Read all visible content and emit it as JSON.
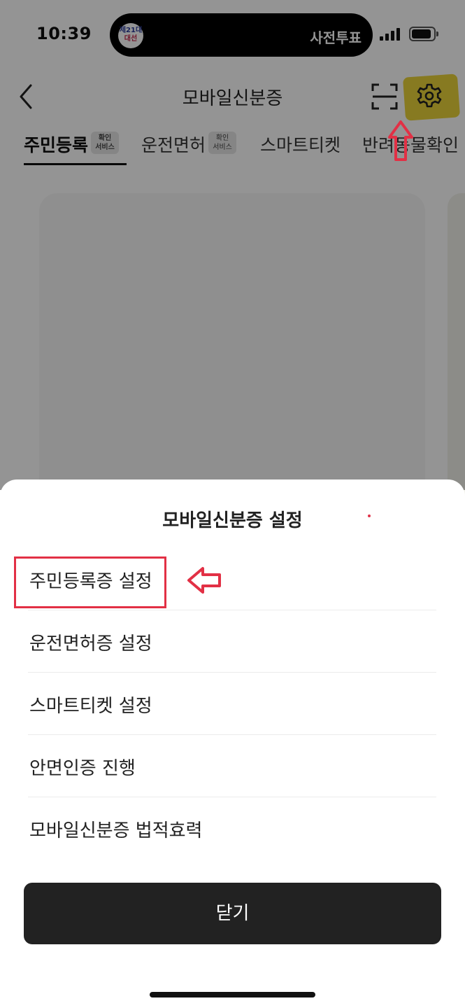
{
  "status_bar": {
    "time": "10:39",
    "live_activity_badge_line1": "제21대",
    "live_activity_badge_line2": "대선",
    "live_activity_text": "사전투표"
  },
  "header": {
    "title": "모바일신분증",
    "back_icon": "chevron-left-icon",
    "scan_icon": "scan-frame-icon",
    "settings_icon": "gear-icon"
  },
  "tabs": [
    {
      "label": "주민등록",
      "badge": "확인\n서비스",
      "active": true
    },
    {
      "label": "운전면허",
      "badge": "확인\n서비스",
      "active": false
    },
    {
      "label": "스마트티켓",
      "active": false
    },
    {
      "label": "반려동물확인",
      "active": false
    }
  ],
  "sheet": {
    "title": "모바일신분증 설정",
    "items": [
      {
        "label": "주민등록증 설정"
      },
      {
        "label": "운전면허증 설정"
      },
      {
        "label": "스마트티켓 설정"
      },
      {
        "label": "안면인증 진행"
      },
      {
        "label": "모바일신분증 법적효력"
      }
    ],
    "close_label": "닫기"
  },
  "colors": {
    "highlight_yellow": "#e9d23a",
    "annotation_red": "#e23045",
    "dim_overlay": "rgba(0,0,0,0.42)",
    "button_dark": "#222222"
  }
}
